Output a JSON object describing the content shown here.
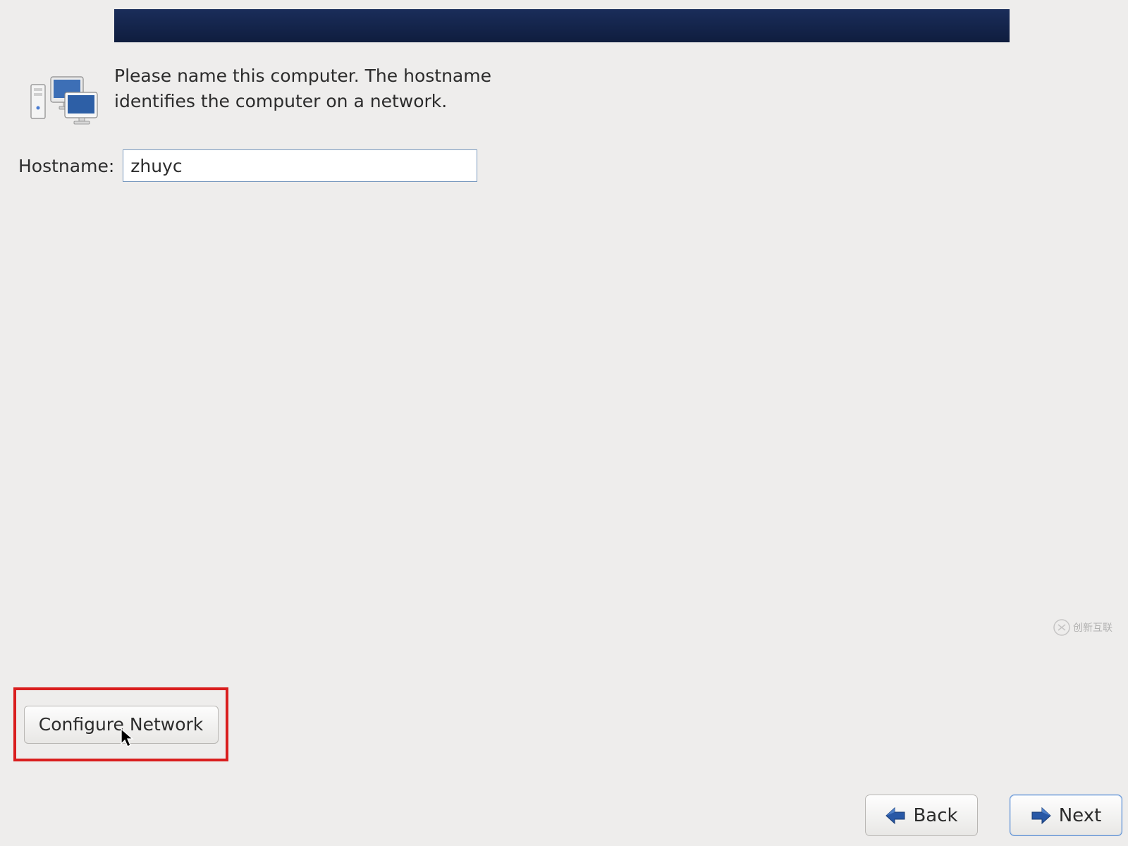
{
  "banner": {},
  "intro": {
    "text": "Please name this computer.  The hostname identifies the computer on a network."
  },
  "hostname": {
    "label": "Hostname:",
    "value": "zhuyc"
  },
  "buttons": {
    "configure_network_label": "Configure Network",
    "back_label": "Back",
    "next_label": "Next"
  },
  "watermark": {
    "text": "创新互联"
  }
}
